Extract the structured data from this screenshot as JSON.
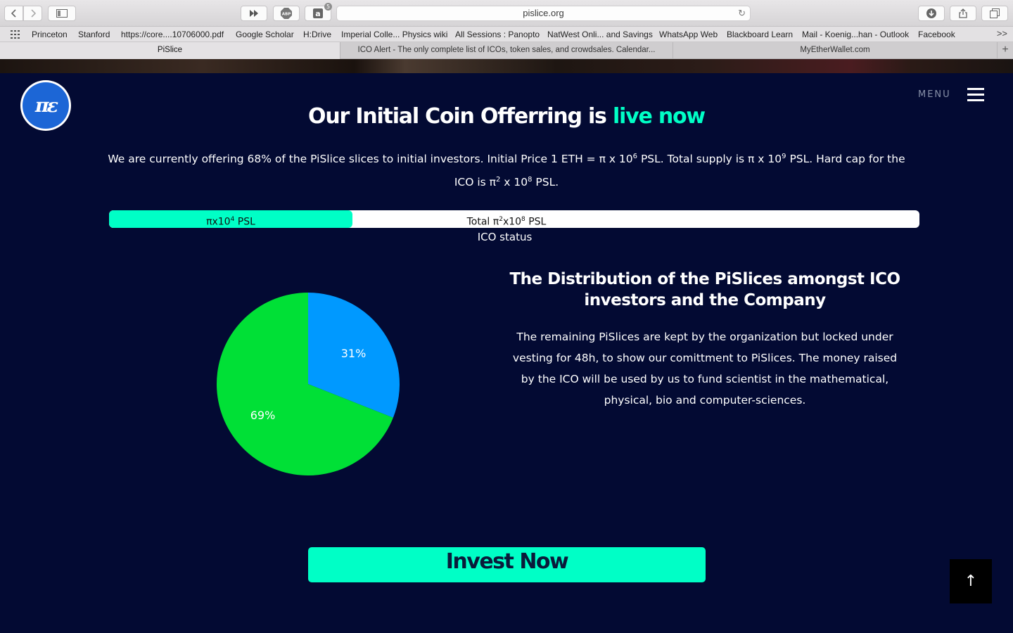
{
  "browser": {
    "url": "pislice.org",
    "extension_badge": "5",
    "bookmarks": [
      "Princeton",
      "Stanford",
      "https://core....10706000.pdf",
      "Google Scholar",
      "H:Drive",
      "Imperial Colle... Physics wiki",
      "All Sessions : Panopto",
      "NatWest Onli... and Savings",
      "WhatsApp Web",
      "Blackboard Learn",
      "Mail - Koenig...han - Outlook",
      "Facebook"
    ],
    "bookmarks_more": ">>",
    "tabs": [
      {
        "label": "PiSlice",
        "active": true
      },
      {
        "label": "ICO Alert - The only complete list of ICOs, token sales, and crowdsales. Calendar...",
        "active": false
      },
      {
        "label": "MyEtherWallet.com",
        "active": false
      }
    ],
    "new_tab": "+"
  },
  "site": {
    "logo_text": "πε",
    "menu_label": "MENU",
    "headline": {
      "text": "Our Initial Coin Offerring is ",
      "accent": "live now"
    },
    "intro": {
      "p1": "We are currently offering 68% of the PiSlice slices to initial investors. Initial Price 1 ETH = π x 10",
      "e1": "6",
      "p2": " PSL. Total supply is π x 10",
      "e2": "9",
      "p3": " PSL. Hard cap for the ICO is π",
      "e3": "2",
      "p4": " x 10",
      "e4": "8",
      "p5": " PSL."
    },
    "progress": {
      "fill_fraction": 0.3,
      "raised_base": "πx10",
      "raised_exp": "4",
      "raised_unit": " PSL",
      "total_base": "Total π",
      "total_exp1": "2",
      "total_mid": "x10",
      "total_exp2": "8",
      "total_unit": " PSL",
      "status_label": "ICO status"
    },
    "distribution": {
      "title": "The Distribution of the PiSlices amongst ICO investors and the Company",
      "body": "The remaining PiSlices are kept by the organization but locked under vesting for 48h, to show our comittment to PiSlices. The money raised by the ICO will be used by us to fund scientist in the mathematical, physical, bio and computer-sciences."
    },
    "invest_label": "Invest Now",
    "to_top_label": "↑",
    "colors": {
      "background": "#030a33",
      "accent": "#00ffc6",
      "pie_blue": "#0099ff",
      "pie_green": "#00e036"
    }
  },
  "chart_data": {
    "type": "pie",
    "labels": [
      "31%",
      "69%"
    ],
    "values": [
      31,
      69
    ],
    "colors": [
      "#0099ff",
      "#00e036"
    ]
  }
}
